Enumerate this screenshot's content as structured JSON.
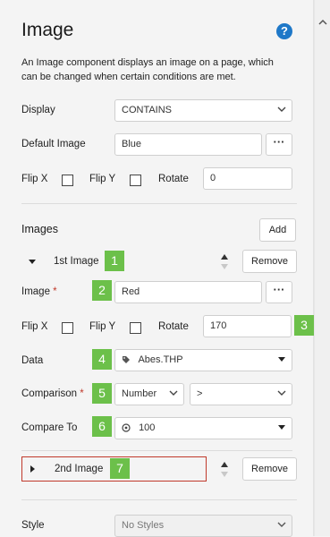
{
  "header": {
    "title": "Image",
    "help_glyph": "?",
    "description": "An Image component displays an image on a page, which can be changed when certain conditions are met."
  },
  "display": {
    "label": "Display",
    "value": "CONTAINS"
  },
  "default_image": {
    "label": "Default Image",
    "value": "Blue",
    "browse_label": "···"
  },
  "top_flip": {
    "flip_x_label": "Flip X",
    "flip_y_label": "Flip Y",
    "rotate_label": "Rotate",
    "rotate_value": "0"
  },
  "images": {
    "title": "Images",
    "add_label": "Add",
    "first": {
      "label": "1st Image",
      "remove_label": "Remove",
      "image_label": "Image",
      "required_mark": "*",
      "image_value": "Red",
      "browse_label": "···",
      "flip_x_label": "Flip X",
      "flip_y_label": "Flip Y",
      "rotate_label": "Rotate",
      "rotate_value": "170",
      "data_label": "Data",
      "data_value": "Abes.THP",
      "comparison_label": "Comparison",
      "comparison_type": "Number",
      "comparison_operator": ">",
      "compare_to_label": "Compare To",
      "compare_to_value": "100"
    },
    "second": {
      "label": "2nd Image",
      "remove_label": "Remove"
    }
  },
  "style": {
    "label": "Style",
    "value": "No Styles"
  },
  "badges": [
    "1",
    "2",
    "3",
    "4",
    "5",
    "6",
    "7"
  ],
  "colors": {
    "accent": "#1e78c8",
    "badge": "#6cc04a",
    "highlight_border": "#c0392b"
  }
}
